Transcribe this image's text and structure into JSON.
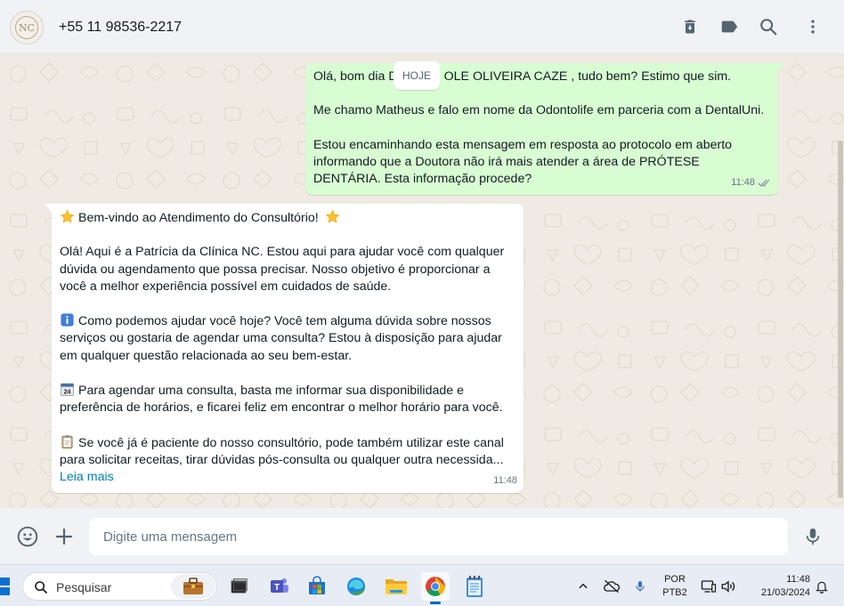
{
  "header": {
    "avatar_text": "NC",
    "contact_name": "+55 11 98536-2217",
    "icons": [
      "delete-icon",
      "label-icon",
      "search-icon",
      "menu-icon"
    ]
  },
  "chat": {
    "date_chip": "HOJE",
    "outgoing": {
      "line1_start": "Olá, bom dia D",
      "line1_end": "OLE OLIVEIRA CAZE , tudo bem? Estimo que sim.",
      "para2": "Me chamo Matheus e falo em nome da Odontolife em parceria com a DentalUni.",
      "para3": "Estou encaminhando esta mensagem em resposta ao protocolo em aberto informando que a Doutora não irá mais atender a área de PRÓTESE DENTÁRIA. Esta informação procede?",
      "time": "11:48",
      "status_icon": "double-check-icon"
    },
    "incoming": {
      "title": "Bem-vindo ao Atendimento do Consultório!",
      "para1": "Olá! Aqui é a Patrícia da Clínica NC. Estou aqui para ajudar você com qualquer dúvida ou agendamento que possa precisar. Nosso objetivo é proporcionar a você a melhor experiência possível em cuidados de saúde.",
      "para2": "Como podemos ajudar você hoje? Você tem alguma dúvida sobre nossos serviços ou gostaria de agendar uma consulta? Estou à disposição para ajudar em qualquer questão relacionada ao seu bem-estar.",
      "para3": "Para agendar uma consulta, basta me informar sua disponibilidade e preferência de horários, e ficarei feliz em encontrar o melhor horário para você.",
      "para4": "Se você já é paciente do nosso consultório, pode também utilizar este canal para solicitar receitas, tirar dúvidas pós-consulta ou qualquer outra necessida...",
      "read_more": "Leia mais",
      "time": "11:48",
      "calendar_day": "24",
      "emoji_icons": [
        "star-icon",
        "info-icon",
        "calendar-icon",
        "clipboard-icon"
      ]
    }
  },
  "composer": {
    "placeholder": "Digite uma mensagem",
    "icons": [
      "emoji-icon",
      "plus-icon",
      "microphone-icon"
    ]
  },
  "taskbar": {
    "search_label": "Pesquisar",
    "apps": [
      "briefcase-icon",
      "terminal-icon",
      "teams-icon",
      "store-icon",
      "edge-icon",
      "file-explorer-icon",
      "chrome-icon",
      "notepad-icon"
    ],
    "lang_line1": "POR",
    "lang_line2": "PTB2",
    "time": "11:48",
    "date": "21/03/2024"
  },
  "colors": {
    "outgoing_bubble": "#d9fdd3",
    "incoming_bubble": "#ffffff",
    "chat_background": "#efeae2",
    "header_background": "#f0f2f5",
    "link": "#027eb5"
  }
}
